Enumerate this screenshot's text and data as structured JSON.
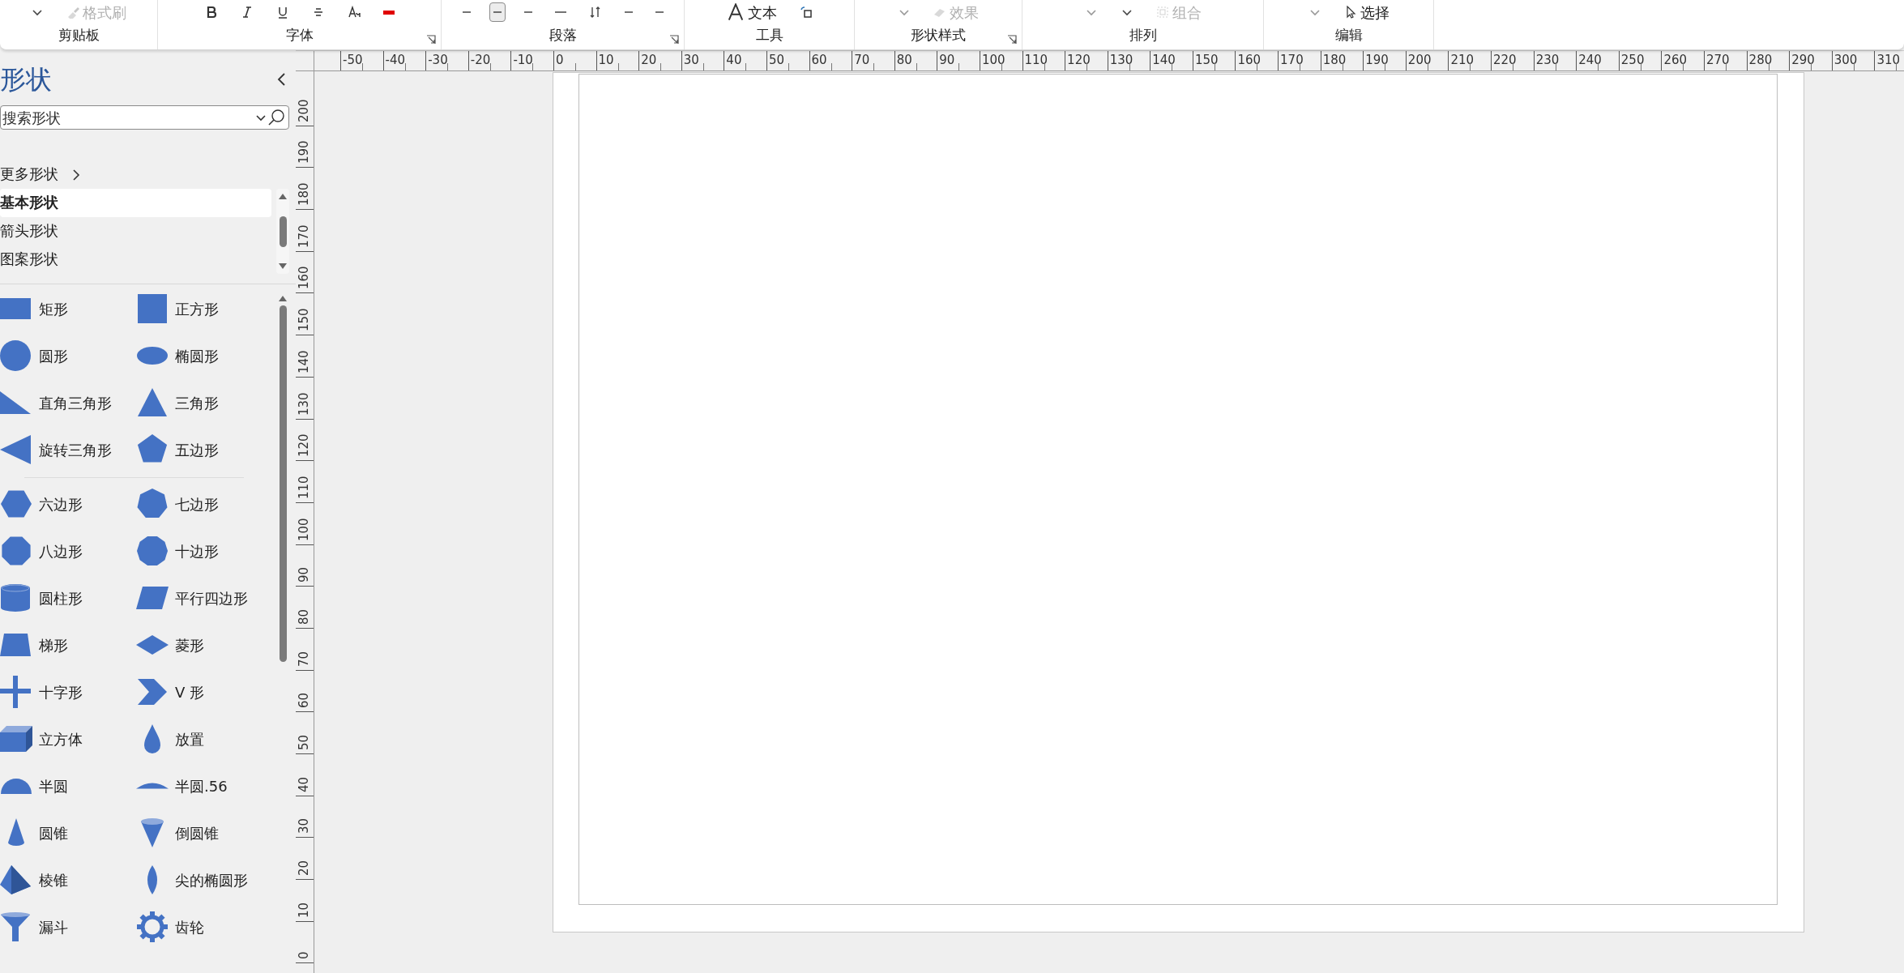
{
  "ribbon": {
    "groups": [
      {
        "label": "剪贴板",
        "launcher": false,
        "items": [
          {
            "kind": "caret",
            "pressed": false,
            "disabled": false
          },
          {
            "kind": "brush",
            "label": "格式刷",
            "pressed": false,
            "disabled": true
          }
        ]
      },
      {
        "label": "字体",
        "launcher": true,
        "items": [
          {
            "kind": "bold",
            "pressed": false,
            "disabled": false
          },
          {
            "kind": "italic",
            "pressed": false,
            "disabled": false
          },
          {
            "kind": "underline",
            "pressed": false,
            "disabled": false
          },
          {
            "kind": "strike",
            "pressed": false,
            "disabled": false
          },
          {
            "kind": "case",
            "pressed": false,
            "disabled": false
          },
          {
            "kind": "font-color",
            "pressed": false,
            "disabled": false
          }
        ]
      },
      {
        "label": "段落",
        "launcher": true,
        "items": [
          {
            "kind": "align-left",
            "pressed": false,
            "disabled": false
          },
          {
            "kind": "align-center",
            "pressed": true,
            "disabled": false
          },
          {
            "kind": "align-right",
            "pressed": false,
            "disabled": false
          },
          {
            "kind": "justify",
            "pressed": false,
            "disabled": false
          },
          {
            "kind": "spacing",
            "pressed": false,
            "disabled": false
          },
          {
            "kind": "align-left",
            "pressed": false,
            "disabled": false
          },
          {
            "kind": "align-right",
            "pressed": false,
            "disabled": false
          }
        ]
      },
      {
        "label": "工具",
        "launcher": false,
        "items": [
          {
            "kind": "text",
            "label": "文本",
            "pressed": false,
            "disabled": false
          },
          {
            "kind": "connector",
            "pressed": false,
            "disabled": false
          }
        ]
      },
      {
        "label": "形状样式",
        "launcher": true,
        "items": [
          {
            "kind": "caret",
            "pressed": false,
            "disabled": true
          },
          {
            "kind": "eraser",
            "label": "效果",
            "pressed": false,
            "disabled": true
          }
        ]
      },
      {
        "label": "排列",
        "launcher": false,
        "items": [
          {
            "kind": "caret",
            "pressed": false,
            "disabled": true
          },
          {
            "kind": "caret",
            "pressed": false,
            "disabled": false
          },
          {
            "kind": "group",
            "label": "组合",
            "pressed": false,
            "disabled": true
          }
        ]
      },
      {
        "label": "编辑",
        "launcher": false,
        "items": [
          {
            "kind": "caret",
            "pressed": false,
            "disabled": true
          },
          {
            "kind": "pointer",
            "label": "选择",
            "pressed": false,
            "disabled": false
          }
        ]
      }
    ]
  },
  "shapes_panel": {
    "title": "形状",
    "search": {
      "placeholder": "搜索形状"
    },
    "more_shapes": "更多形状",
    "stencils": [
      {
        "label": "基本形状",
        "selected": true
      },
      {
        "label": "箭头形状",
        "selected": false
      },
      {
        "label": "图案形状",
        "selected": false
      }
    ],
    "shape_groups": [
      [
        {
          "kind": "rectangle",
          "label": "矩形"
        },
        {
          "kind": "square",
          "label": "正方形"
        },
        {
          "kind": "circle",
          "label": "圆形"
        },
        {
          "kind": "ellipse",
          "label": "椭圆形"
        },
        {
          "kind": "right-triangle",
          "label": "直角三角形"
        },
        {
          "kind": "triangle",
          "label": "三角形"
        },
        {
          "kind": "rotated-triangle",
          "label": "旋转三角形"
        },
        {
          "kind": "pentagon",
          "label": "五边形"
        }
      ],
      [
        {
          "kind": "hexagon",
          "label": "六边形"
        },
        {
          "kind": "heptagon",
          "label": "七边形"
        },
        {
          "kind": "octagon",
          "label": "八边形"
        },
        {
          "kind": "decagon",
          "label": "十边形"
        },
        {
          "kind": "cylinder",
          "label": "圆柱形"
        },
        {
          "kind": "parallelogram",
          "label": "平行四边形"
        },
        {
          "kind": "trapezoid",
          "label": "梯形"
        },
        {
          "kind": "diamond",
          "label": "菱形"
        },
        {
          "kind": "cross",
          "label": "十字形"
        },
        {
          "kind": "chevron",
          "label": "V 形"
        },
        {
          "kind": "cube",
          "label": "立方体"
        },
        {
          "kind": "drop",
          "label": "放置"
        },
        {
          "kind": "semicircle",
          "label": "半圆"
        },
        {
          "kind": "segment",
          "label": "半圆.56"
        },
        {
          "kind": "cone",
          "label": "圆锥"
        },
        {
          "kind": "inverted-cone",
          "label": "倒圆锥"
        },
        {
          "kind": "pyramid",
          "label": "棱锥"
        },
        {
          "kind": "pointed-ellipse",
          "label": "尖的椭圆形"
        },
        {
          "kind": "funnel",
          "label": "漏斗"
        },
        {
          "kind": "gear",
          "label": "齿轮"
        }
      ]
    ]
  },
  "ruler": {
    "horizontal": [
      "-50",
      "-40",
      "-30",
      "-20",
      "-10",
      "0",
      "10",
      "20",
      "30",
      "40",
      "50",
      "60",
      "70",
      "80",
      "90",
      "100",
      "110",
      "120",
      "130",
      "140",
      "150",
      "160",
      "170",
      "180",
      "190",
      "200",
      "210",
      "220",
      "230",
      "240",
      "250",
      "260",
      "270",
      "280",
      "290",
      "300",
      "310"
    ],
    "vertical": [
      "200",
      "190",
      "180",
      "170",
      "160",
      "150",
      "140",
      "130",
      "120",
      "110",
      "100",
      "90",
      "80",
      "70",
      "60",
      "50",
      "40",
      "30",
      "20",
      "10",
      "0"
    ]
  }
}
